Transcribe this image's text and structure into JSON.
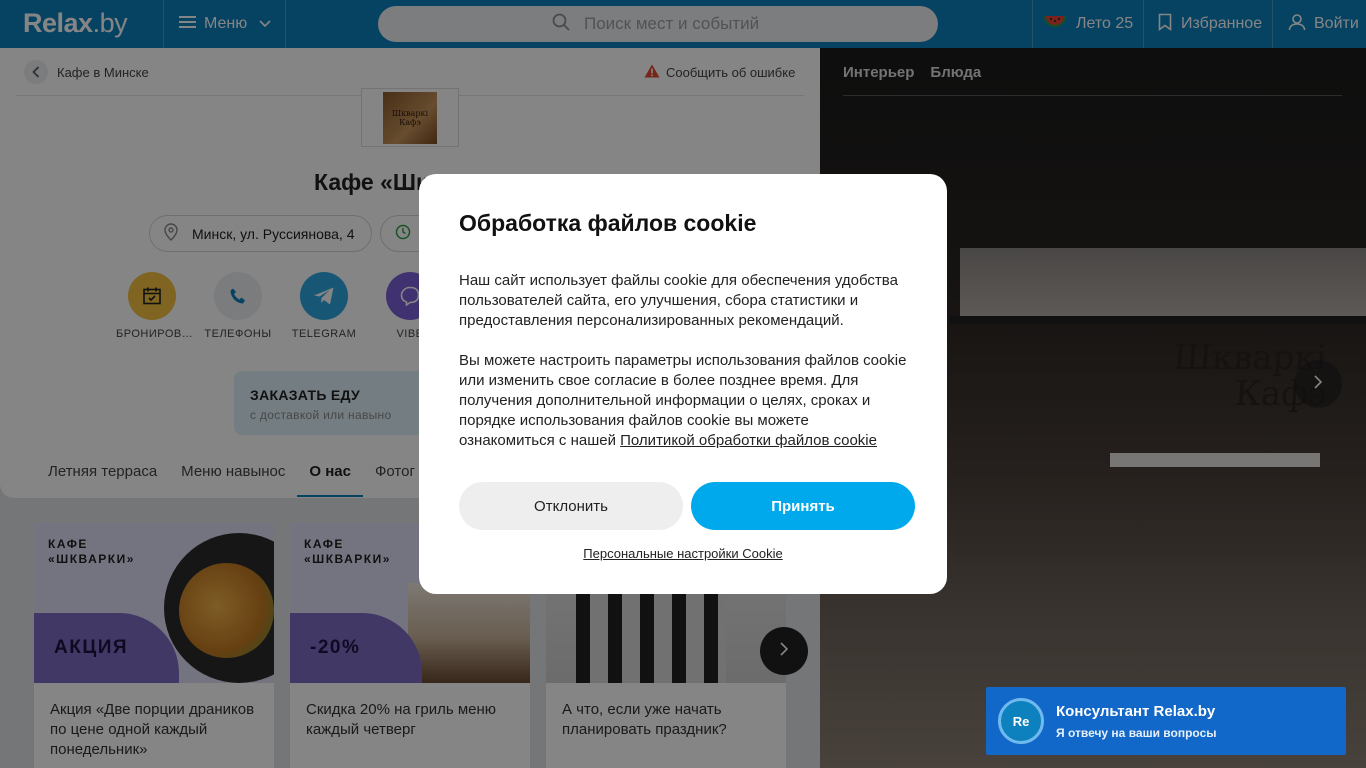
{
  "header": {
    "logo_main": "Relax",
    "logo_tld": ".by",
    "menu_label": "Меню",
    "search_placeholder": "Поиск мест и событий",
    "summer_label": "Лето 25",
    "favorites_label": "Избранное",
    "login_label": "Войти"
  },
  "breadcrumb": {
    "back_label": "Кафе в Минске"
  },
  "report_label": "Сообщить об ошибке",
  "venue": {
    "logo_text": "Шкваркі Кафэ",
    "title": "Кафе «Шк",
    "address": "Минск, ул. Руссиянова, 4"
  },
  "actions": [
    {
      "label": "БРОНИРОВ…",
      "icon": "calendar-icon",
      "color": "#f5c242"
    },
    {
      "label": "ТЕЛЕФОНЫ",
      "icon": "phone-icon",
      "color": "#eceef0"
    },
    {
      "label": "TELEGRAM",
      "icon": "telegram-icon",
      "color": "#2fa5e0"
    },
    {
      "label": "VIBE",
      "icon": "viber-icon",
      "color": "#7c5fd6"
    }
  ],
  "order": {
    "title": "ЗАКАЗАТЬ ЕДУ",
    "subtitle": "с доставкой или навыно"
  },
  "tabs": [
    {
      "label": "Летняя терраса",
      "active": false
    },
    {
      "label": "Меню навынос",
      "active": false
    },
    {
      "label": "О нас",
      "active": true
    },
    {
      "label": "Фотог",
      "active": false
    }
  ],
  "promos": [
    {
      "brand_line1": "КАФЕ",
      "brand_line2": "«ШКВАРКИ»",
      "badge": "АКЦИЯ",
      "caption": "Акция «Две порции драников по цене одной каждый понедельник»"
    },
    {
      "brand_line1": "КАФЕ",
      "brand_line2": "«ШКВАРКИ»",
      "badge": "-20%",
      "caption": "Скидка 20% на гриль меню каждый четверг"
    },
    {
      "brand_line1": "",
      "brand_line2": "",
      "badge": "",
      "caption": "А что, если уже начать планировать праздник?"
    }
  ],
  "photo": {
    "tabs": [
      "Интерьер",
      "Блюда"
    ],
    "sign_line1": "Шкваркі",
    "sign_line2": "Кафэ"
  },
  "cookie": {
    "title": "Обработка файлов cookie",
    "p1": "Наш сайт использует файлы cookie для обеспечения удобства пользователей сайта, его улучшения, сбора статистики и предоставления персонализированных рекомендаций.",
    "p2": "Вы можете настроить параметры использования файлов cookie или изменить свое согласие в более позднее время. Для получения дополнительной информации о целях, сроках и порядке использования файлов cookie вы можете ознакомиться с нашей",
    "policy_link": "Политикой обработки файлов cookie",
    "decline": "Отклонить",
    "accept": "Принять",
    "personal": "Персональные настройки Cookie"
  },
  "consultant": {
    "avatar": "Re",
    "title": "Консультант Relax.by",
    "subtitle": "Я отвечу на ваши вопросы"
  },
  "colors": {
    "brand": "#0d81bd",
    "accept": "#00a9ec",
    "promo_badge": "#7f6bc4",
    "consultant": "#1268c9"
  }
}
